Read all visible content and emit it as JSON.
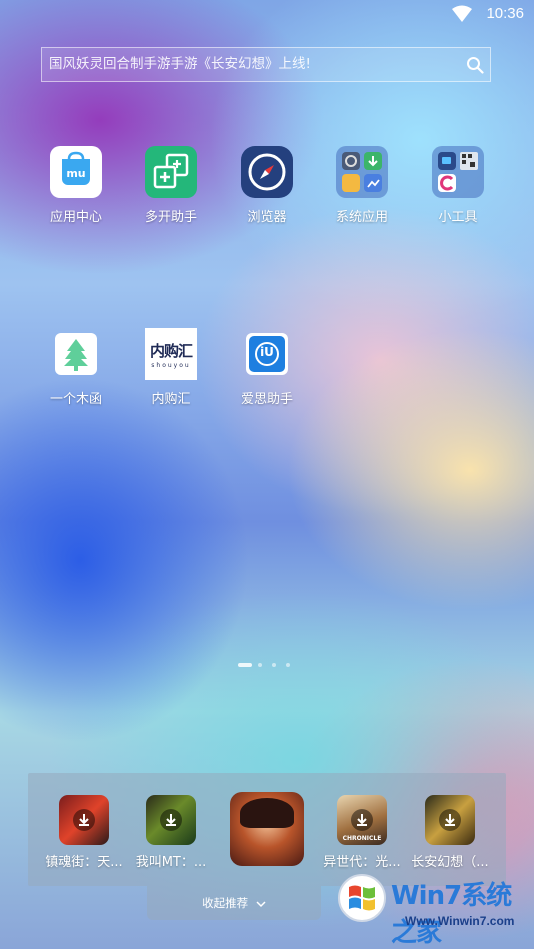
{
  "status": {
    "time": "10:36"
  },
  "search": {
    "text": "国风妖灵回合制手游手游《长安幻想》上线!"
  },
  "apps_row1": [
    {
      "label": "应用中心",
      "icon": "app-store-icon"
    },
    {
      "label": "多开助手",
      "icon": "multi-open-icon"
    },
    {
      "label": "浏览器",
      "icon": "browser-compass-icon"
    },
    {
      "label": "系统应用",
      "icon": "folder-icon"
    },
    {
      "label": "小工具",
      "icon": "folder-icon"
    }
  ],
  "apps_row2": [
    {
      "label": "一个木函",
      "icon": "tree-icon"
    },
    {
      "label": "内购汇",
      "icon": "neigouhui-logo",
      "logo_text": "内购汇",
      "logo_sub": "shouyou"
    },
    {
      "label": "爱思助手",
      "icon": "i4-logo-icon",
      "logo_text": "iU"
    }
  ],
  "recommend": {
    "games": [
      {
        "label": "镇魂街：天..."
      },
      {
        "label": "我叫MT：..."
      },
      {
        "label": ""
      },
      {
        "label": "异世代：光..."
      },
      {
        "label": "长安幻想（..."
      }
    ],
    "collapse_label": "收起推荐",
    "chronicle_text": "CHRONICLE"
  },
  "watermark": {
    "brand": "Win7系统之家",
    "url": "Www.Winwin7.com"
  },
  "colors": {
    "accent": "#2a7ad8",
    "green": "#2bb673",
    "navy": "#23407a"
  }
}
